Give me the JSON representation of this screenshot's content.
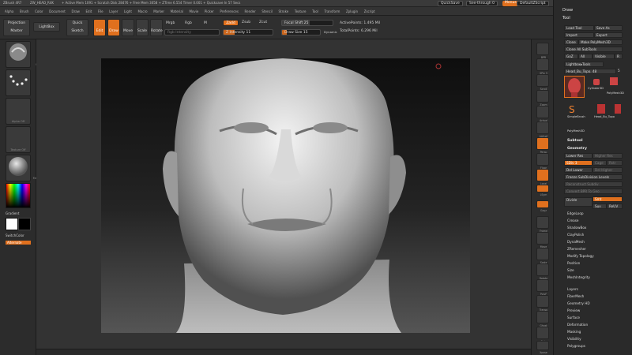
{
  "window": {
    "app": "ZBrush 4R7",
    "document": "ZW_HEAD_R4K",
    "stats": "+ Active Mem 1091 + Scratch Disk 28476 + Free Mem 3058 + ZTime 6.554 Timer 0.001 + Quicksave In 57 Secs"
  },
  "topright": {
    "quicksave": "QuickSave",
    "seethrough": "See-through   0",
    "menus": "Menus",
    "defaultscript": "DefaultZScript"
  },
  "menubar": [
    "Alpha",
    "Brush",
    "Color",
    "Document",
    "Draw",
    "Edit",
    "File",
    "Layer",
    "Light",
    "Macro",
    "Marker",
    "Material",
    "Movie",
    "Picker",
    "Preferences",
    "Render",
    "Stencil",
    "Stroke",
    "Texture",
    "Tool",
    "Transform",
    "Zplugin",
    "Zscript"
  ],
  "shelf": {
    "projection_master": "Projection Master",
    "lightbox": "LightBox",
    "quick_sketch": "Quick Sketch",
    "edit": "Edit",
    "draw": "Draw",
    "move": "Move",
    "scale": "Scale",
    "rotate": "Rotate",
    "mrgb": "Mrgb",
    "rgb": "Rgb",
    "m": "M",
    "rgb_intensity": "Rgb Intensity",
    "zadd": "Zadd",
    "zsub": "Zsub",
    "zcut": "Zcut",
    "z_intensity": "Z Intensity 11",
    "focal_shift": "Focal Shift 25",
    "draw_size": "Draw Size 15",
    "dynamic": "Dynamic",
    "active_points": "ActivePoints: 1.495 Mil",
    "total_points": "TotalPoints: 6.296 Mil"
  },
  "lefttray": {
    "brush_caption": "Standard",
    "stroke_caption": "Dots",
    "alpha_caption": "Alpha Off",
    "texture_caption": "Texture Off",
    "material_caption": "MatCap Gray",
    "gradient": "Gradient",
    "switchcolor": "SwitchColor",
    "alternate": "Alternate"
  },
  "rightstrip": [
    "BPR",
    "SPix 3",
    "Scroll",
    "Zoom",
    "Actual",
    "AAHalf",
    "Persp",
    "Floor",
    "Local",
    "LSym",
    "Gxyz",
    "Frame",
    "Move",
    "Scale",
    "Rotate",
    "PolyF",
    "Transp",
    "Ghost",
    "Solo",
    "Xpose"
  ],
  "palette": {
    "draw": "Draw",
    "tool": "Tool",
    "load_tool": "Load Tool",
    "save_as": "Save As",
    "import": "Import",
    "export": "Export",
    "clone": "Clone",
    "make_polymesh": "Make PolyMesh3D",
    "clone_all": "Clone All SubTools",
    "goz": "GoZ",
    "all": "All",
    "visible": "Visible",
    "r": "R",
    "lightbox_tools": "Lightbox▸Tools",
    "current_tool": "Head_Bu_Topo. 48",
    "tool_num": "5",
    "cylinder": "Cylinder3D",
    "polymesh": "PolyMesh3D",
    "simplebrush": "SimpleBrush",
    "head_topo": "Head_Bu_Topo",
    "polymesh2": "PolyMesh3D",
    "subtool": "Subtool",
    "geometry": "Geometry",
    "lower_res": "Lower Res",
    "higher_res": "Higher Res",
    "sdiv": "SDiv 3",
    "cage": "Cage",
    "rstr": "Rstr",
    "del_lower": "Del Lower",
    "del_higher": "Del Higher",
    "freeze": "Freeze SubDivision Levels",
    "reconstruct": "Reconstruct Subdiv",
    "convert_bpr": "Convert BPR To Geo",
    "divide": "Divide",
    "smt": "Smt",
    "suv": "Suv",
    "reuv": "ReUV",
    "edgeloop": "EdgeLoop",
    "crease": "Crease",
    "shadowbox": "ShadowBox",
    "claypolish": "ClayPolish",
    "dynamesh": "DynaMesh",
    "zremesher": "ZRemesher",
    "modify_topology": "Modify Topology",
    "position": "Position",
    "size": "Size",
    "meshintegrity": "MeshIntegrity",
    "layers": "Layers",
    "fibermesh": "FiberMesh",
    "geometry_hd": "Geometry HD",
    "preview": "Preview",
    "surface": "Surface",
    "deformation": "Deformation",
    "masking": "Masking",
    "visibility": "Visibility",
    "polygroups": "Polygroups"
  },
  "colors": {
    "accent": "#e0701e",
    "bg": "#2b2b2b"
  }
}
